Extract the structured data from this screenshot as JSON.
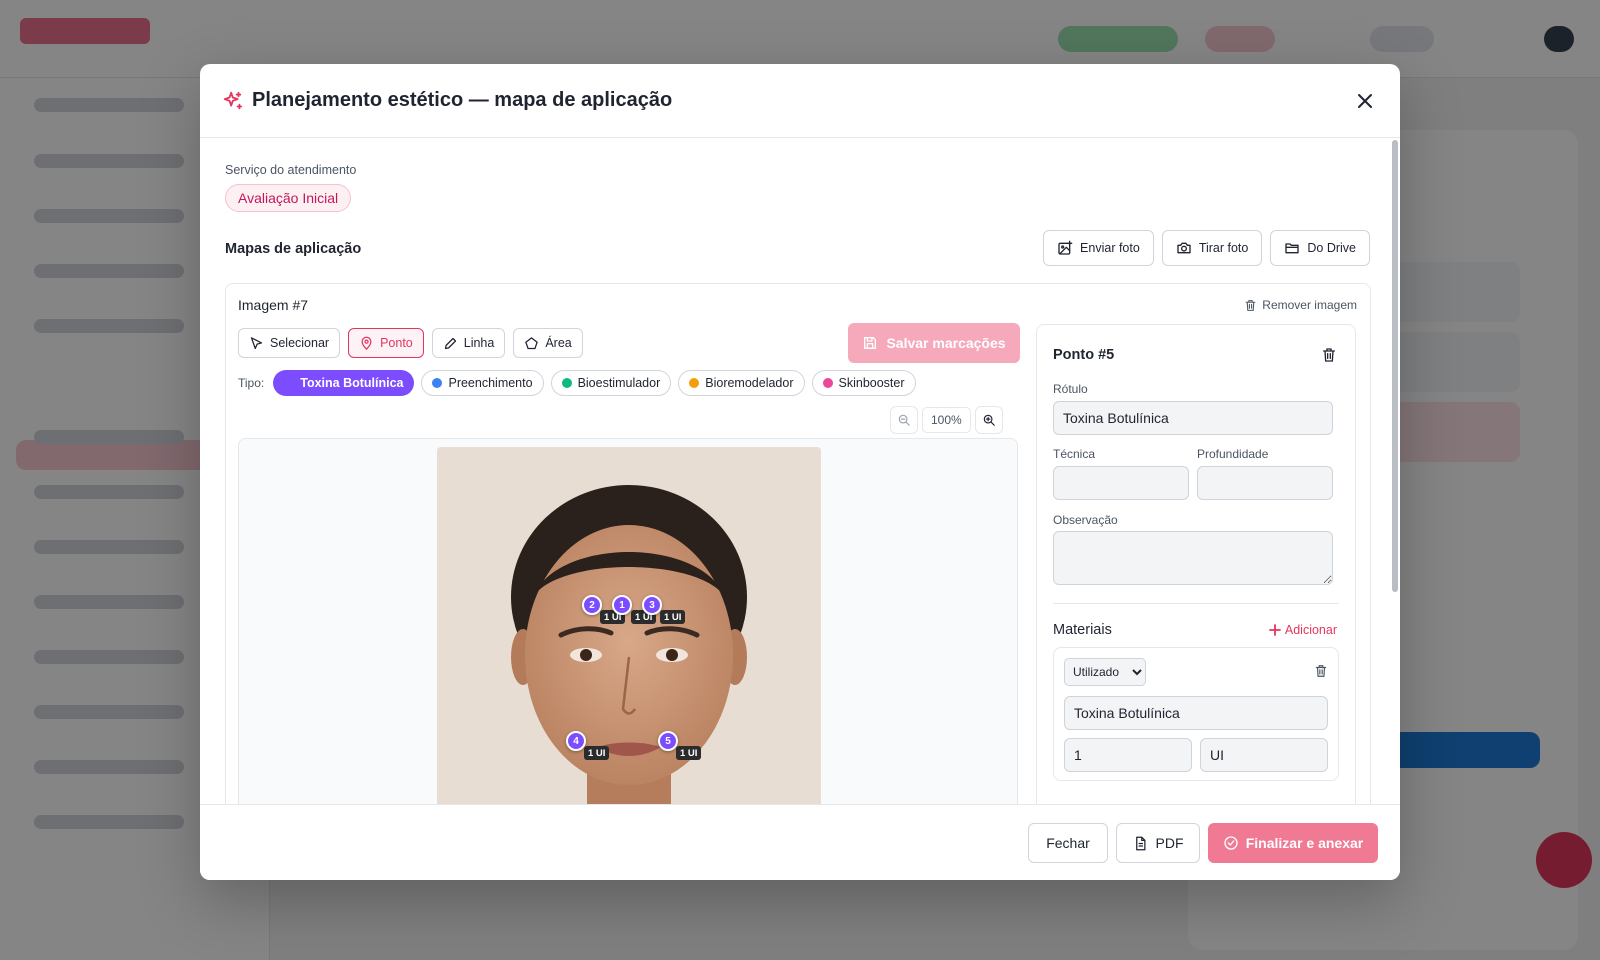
{
  "colors": {
    "accent": "#e2365f",
    "point_marker": "#7c4dff"
  },
  "modal": {
    "title": "Planejamento estético — mapa de aplicação",
    "title_icon": "sparkles-icon",
    "close_icon": "close-icon"
  },
  "service": {
    "label": "Serviço do atendimento",
    "chip": "Avaliação Inicial"
  },
  "maps": {
    "title": "Mapas de aplicação",
    "buttons": [
      {
        "label": "Enviar foto",
        "icon": "image-upload-icon"
      },
      {
        "label": "Tirar foto",
        "icon": "camera-icon"
      },
      {
        "label": "Do Drive",
        "icon": "folder-icon"
      }
    ]
  },
  "image": {
    "title": "Imagem #7",
    "remove_label": "Remover imagem",
    "tools": [
      {
        "label": "Selecionar",
        "icon": "cursor-icon",
        "active": false
      },
      {
        "label": "Ponto",
        "icon": "map-pin-icon",
        "active": true
      },
      {
        "label": "Linha",
        "icon": "pencil-icon",
        "active": false
      },
      {
        "label": "Área",
        "icon": "pentagon-icon",
        "active": false
      }
    ],
    "save_label": "Salvar marcações",
    "type_label": "Tipo:",
    "types": [
      {
        "label": "Toxina Botulínica",
        "color": "#7c4dff",
        "active": true
      },
      {
        "label": "Preenchimento",
        "color": "#3b82f6",
        "active": false
      },
      {
        "label": "Bioestimulador",
        "color": "#10b981",
        "active": false
      },
      {
        "label": "Bioremodelador",
        "color": "#f59e0b",
        "active": false
      },
      {
        "label": "Skinbooster",
        "color": "#ec4899",
        "active": false
      }
    ],
    "zoom": "100%",
    "markers": [
      {
        "n": "2",
        "tag": "1 UI"
      },
      {
        "n": "1",
        "tag": "1 UI"
      },
      {
        "n": "3",
        "tag": "1 UI"
      },
      {
        "n": "4",
        "tag": "1 UI"
      },
      {
        "n": "5",
        "tag": "1 UI"
      }
    ]
  },
  "point": {
    "title": "Ponto #5",
    "rotulo_label": "Rótulo",
    "rotulo_value": "Toxina Botulínica",
    "tecnica_label": "Técnica",
    "tecnica_value": "",
    "profundidade_label": "Profundidade",
    "profundidade_value": "",
    "observacao_label": "Observação",
    "observacao_value": "",
    "materials_title": "Materiais",
    "add_label": "Adicionar",
    "material": {
      "status": "Utilizado",
      "name": "Toxina Botulínica",
      "qty": "1",
      "unit": "UI"
    }
  },
  "footer": {
    "close_label": "Fechar",
    "pdf_label": "PDF",
    "finalize_label": "Finalizar e anexar"
  }
}
